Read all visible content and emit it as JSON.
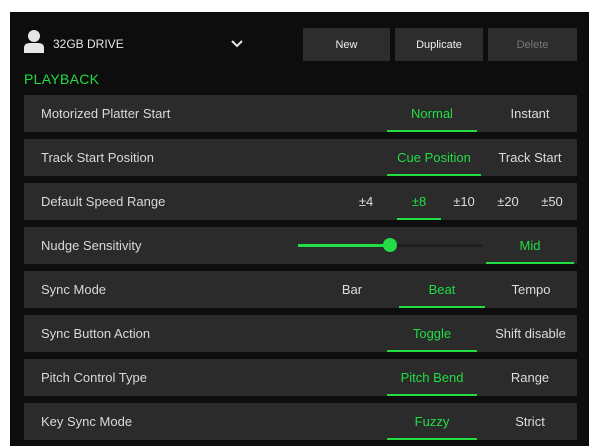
{
  "header": {
    "drive_name": "32GB DRIVE",
    "buttons": {
      "new": "New",
      "duplicate": "Duplicate",
      "delete": "Delete"
    }
  },
  "section_title": "PLAYBACK",
  "settings": [
    {
      "label": "Motorized Platter Start",
      "options": [
        "Normal",
        "Instant"
      ],
      "selected": "Normal"
    },
    {
      "label": "Track Start Position",
      "options": [
        "Cue Position",
        "Track Start"
      ],
      "selected": "Cue Position"
    },
    {
      "label": "Default Speed Range",
      "options": [
        "±4",
        "±8",
        "±10",
        "±20",
        "±50"
      ],
      "selected": "±8"
    },
    {
      "label": "Nudge Sensitivity",
      "value_label": "Mid",
      "level": 0.5
    },
    {
      "label": "Sync Mode",
      "options": [
        "Bar",
        "Beat",
        "Tempo"
      ],
      "selected": "Beat"
    },
    {
      "label": "Sync Button Action",
      "options": [
        "Toggle",
        "Shift disable"
      ],
      "selected": "Toggle"
    },
    {
      "label": "Pitch Control Type",
      "options": [
        "Pitch Bend",
        "Range"
      ],
      "selected": "Pitch Bend"
    },
    {
      "label": "Key Sync Mode",
      "options": [
        "Fuzzy",
        "Strict"
      ],
      "selected": "Fuzzy"
    }
  ],
  "colors": {
    "accent": "#22dd44",
    "background": "#0d0d0d",
    "row": "#2b2b2b",
    "button": "#2d2d2d"
  }
}
